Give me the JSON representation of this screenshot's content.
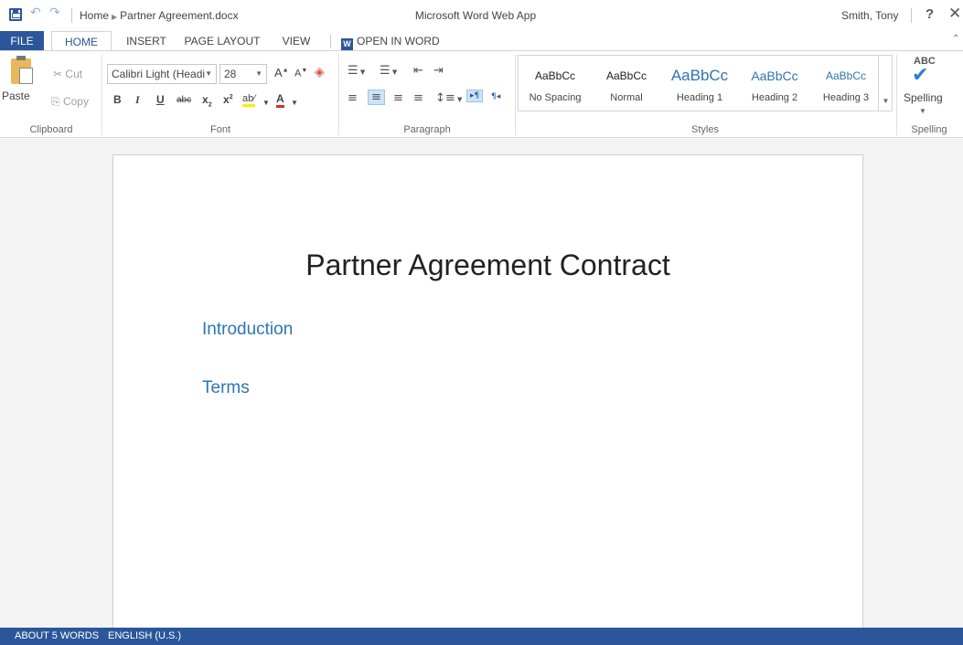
{
  "titlebar": {
    "breadcrumb_home": "Home",
    "breadcrumb_file": "Partner Agreement.docx",
    "app_title": "Microsoft Word Web App",
    "user_name": "Smith, Tony",
    "help_label": "?",
    "close_label": "✕"
  },
  "tabs": {
    "file": "FILE",
    "home": "HOME",
    "insert": "INSERT",
    "page_layout": "PAGE LAYOUT",
    "view": "VIEW",
    "open_in_word": "OPEN IN WORD"
  },
  "clipboard": {
    "paste": "Paste",
    "cut": "Cut",
    "copy": "Copy",
    "group_label": "Clipboard"
  },
  "font": {
    "family": "Calibri Light (Headi",
    "size": "28",
    "group_label": "Font"
  },
  "paragraph": {
    "group_label": "Paragraph"
  },
  "styles": {
    "items": [
      {
        "sample": "AaBbCc",
        "name": "No Spacing"
      },
      {
        "sample": "AaBbCc",
        "name": "Normal"
      },
      {
        "sample": "AaBbCc",
        "name": "Heading 1"
      },
      {
        "sample": "AaBbCc",
        "name": "Heading 2"
      },
      {
        "sample": "AaBbCc",
        "name": "Heading 3"
      }
    ],
    "group_label": "Styles"
  },
  "spelling": {
    "abc": "ABC",
    "label": "Spelling",
    "group_label": "Spelling"
  },
  "document": {
    "title": "Partner Agreement Contract",
    "headings": [
      "Introduction",
      "Terms"
    ]
  },
  "status": {
    "word_count": "ABOUT 5 WORDS",
    "language": "ENGLISH (U.S.)"
  },
  "colors": {
    "accent": "#2b579a",
    "heading": "#2e74b5"
  }
}
